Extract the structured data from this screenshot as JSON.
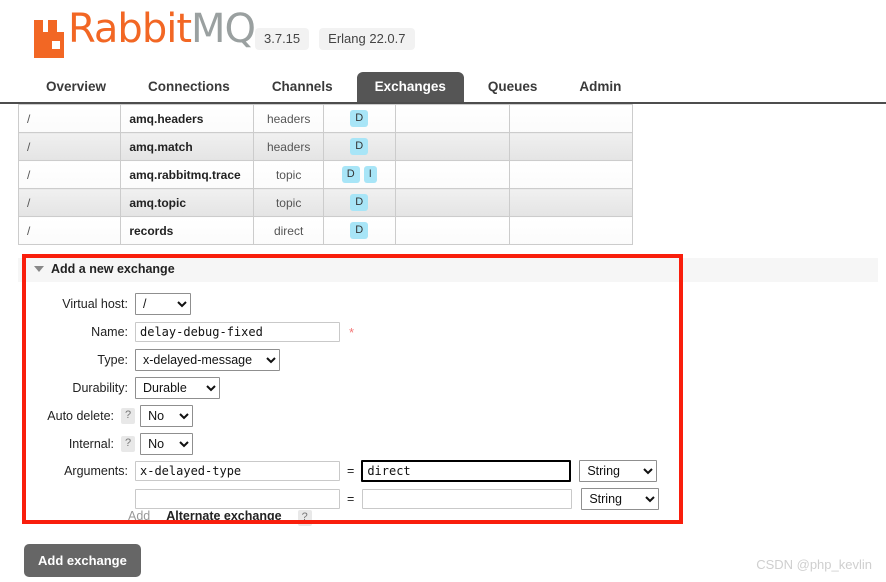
{
  "header": {
    "logo_text_primary": "Rabbit",
    "logo_text_secondary": "MQ",
    "logo_tm": "™",
    "version": "3.7.15",
    "erlang_version": "Erlang 22.0.7"
  },
  "nav": {
    "tabs": [
      {
        "label": "Overview",
        "active": false
      },
      {
        "label": "Connections",
        "active": false
      },
      {
        "label": "Channels",
        "active": false
      },
      {
        "label": "Exchanges",
        "active": true
      },
      {
        "label": "Queues",
        "active": false
      },
      {
        "label": "Admin",
        "active": false
      }
    ]
  },
  "exchanges_table": {
    "rows": [
      {
        "vhost": "/",
        "name": "amq.headers",
        "type": "headers",
        "features": [
          "D"
        ]
      },
      {
        "vhost": "/",
        "name": "amq.match",
        "type": "headers",
        "features": [
          "D"
        ]
      },
      {
        "vhost": "/",
        "name": "amq.rabbitmq.trace",
        "type": "topic",
        "features": [
          "D",
          "I"
        ]
      },
      {
        "vhost": "/",
        "name": "amq.topic",
        "type": "topic",
        "features": [
          "D"
        ]
      },
      {
        "vhost": "/",
        "name": "records",
        "type": "direct",
        "features": [
          "D"
        ]
      }
    ]
  },
  "form": {
    "title": "Add a new exchange",
    "virtual_host": {
      "label": "Virtual host:",
      "value": "/"
    },
    "name": {
      "label": "Name:",
      "value": "delay-debug-fixed",
      "required_marker": "*"
    },
    "type": {
      "label": "Type:",
      "value": "x-delayed-message"
    },
    "durability": {
      "label": "Durability:",
      "value": "Durable"
    },
    "auto_delete": {
      "label": "Auto delete:",
      "help": "?",
      "value": "No"
    },
    "internal": {
      "label": "Internal:",
      "help": "?",
      "value": "No"
    },
    "arguments": {
      "label": "Arguments:",
      "equals": "=",
      "rows": [
        {
          "key": "x-delayed-type",
          "value": "direct",
          "type": "String",
          "focused": true
        },
        {
          "key": "",
          "value": "",
          "type": "String",
          "focused": false
        }
      ]
    },
    "add_link": "Add",
    "alternate_exchange": {
      "label": "Alternate exchange",
      "help": "?"
    }
  },
  "footer": {
    "add_exchange_button": "Add exchange",
    "watermark": "CSDN @php_kevlin"
  },
  "colors": {
    "brand_orange": "#f26724",
    "active_tab": "#555555",
    "feature_badge": "#a8e5f7",
    "annotation_red": "#f91e0c"
  }
}
